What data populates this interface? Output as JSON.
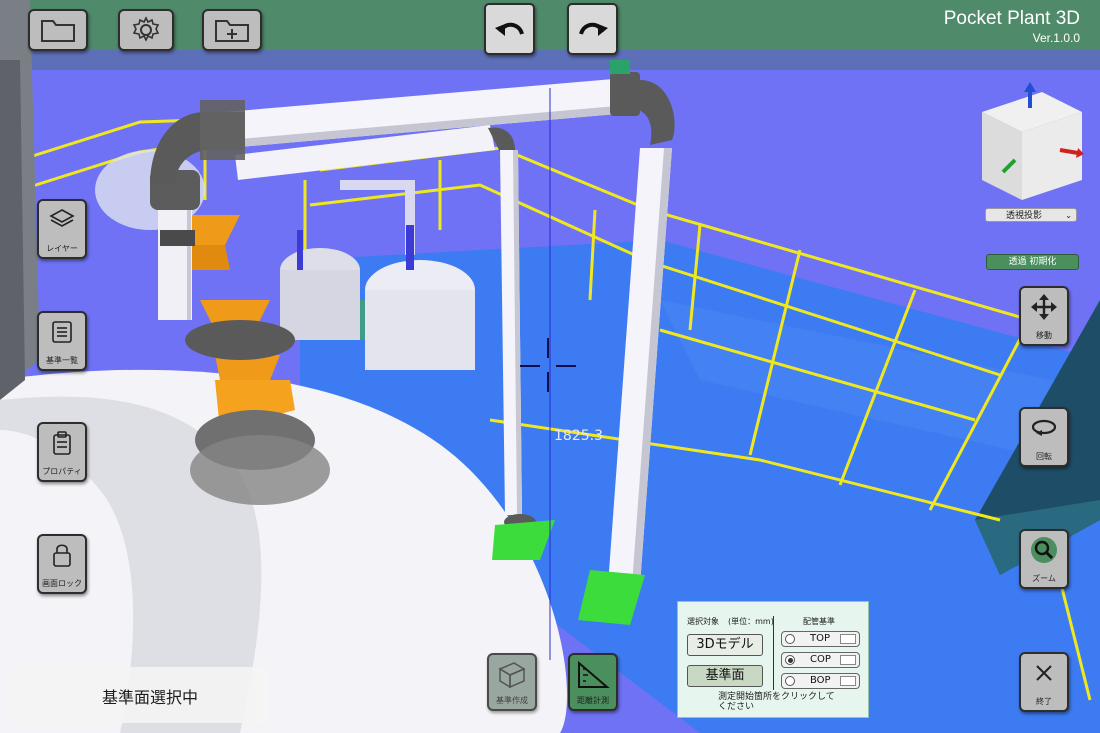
{
  "app": {
    "title": "Pocket Plant 3D",
    "version": "Ver.1.0.0"
  },
  "toolbar": {
    "folder_icon": "folder-icon",
    "settings_icon": "gear-icon",
    "add_folder_icon": "folder-plus-icon",
    "undo_icon": "undo-arrow-icon",
    "redo_icon": "redo-arrow-icon"
  },
  "left_panel": {
    "layer": "レイヤー",
    "base_list": "基準一覧",
    "property": "プロパティ",
    "screen_lock": "画面ロック"
  },
  "right_panel": {
    "projection": "透視投影",
    "reset": "透過 初期化",
    "move": "移動",
    "rotate": "回転",
    "zoom": "ズーム",
    "exit": "終了"
  },
  "status": {
    "text": "基準面選択中"
  },
  "measurement": {
    "value": "1825.3"
  },
  "bottom_tools": {
    "create_base": "基準作成",
    "distance": "距離計測"
  },
  "measure_panel": {
    "target_label": "選択対象",
    "unit_label": "(単位：mm)",
    "ref_label": "配管基準",
    "btn_model": "3Dモデル",
    "btn_plane": "基準面",
    "options": [
      "TOP",
      "COP",
      "BOP"
    ],
    "selected_option": "COP",
    "hint": "測定開始箇所をクリックしてください"
  },
  "colors": {
    "background": "#6f72f4",
    "top_bar": "#4e8c6a",
    "floor": "#3d7bf2",
    "railing": "#f0e81e",
    "pipe": "#f2f2f8",
    "valve": "#f09a1a",
    "base_plate": "#3ddc3d",
    "status_green": "#4a8f5d"
  }
}
